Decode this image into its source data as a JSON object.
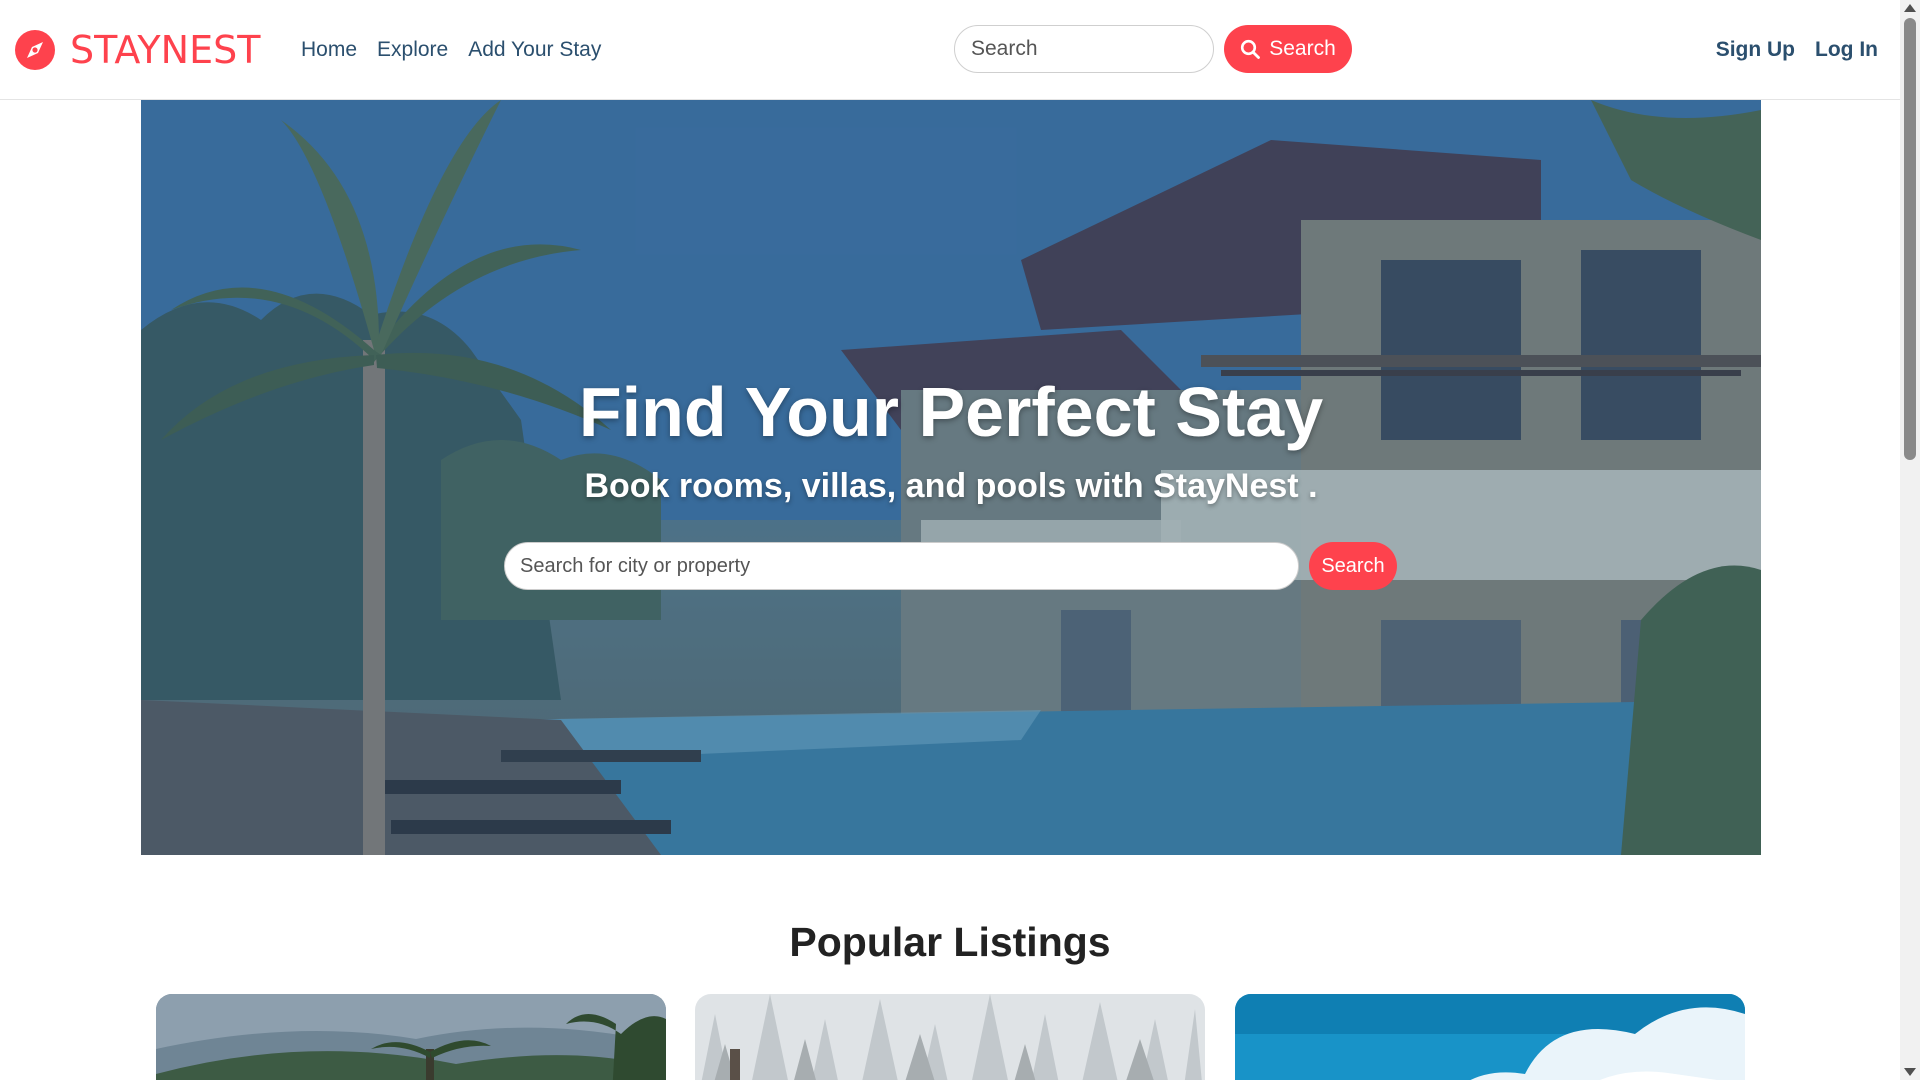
{
  "brand": {
    "name": "STAYNEST",
    "accent_color": "#fe424d",
    "icon": "compass-icon"
  },
  "nav": {
    "links": [
      "Home",
      "Explore",
      "Add Your Stay"
    ],
    "search_placeholder": "Search",
    "search_button": "Search",
    "search_icon": "magnifier-icon",
    "sign_up": "Sign Up",
    "log_in": "Log In"
  },
  "hero": {
    "title": "Find Your Perfect Stay",
    "subtitle": "Book rooms, villas, and pools with StayNest .",
    "search_placeholder": "Search for city or property",
    "search_button": "Search"
  },
  "listings": {
    "title": "Popular Listings",
    "cards": [
      {
        "image": "tropical-palms-photo"
      },
      {
        "image": "snowy-forest-photo"
      },
      {
        "image": "blue-sky-clouds-photo"
      }
    ]
  }
}
